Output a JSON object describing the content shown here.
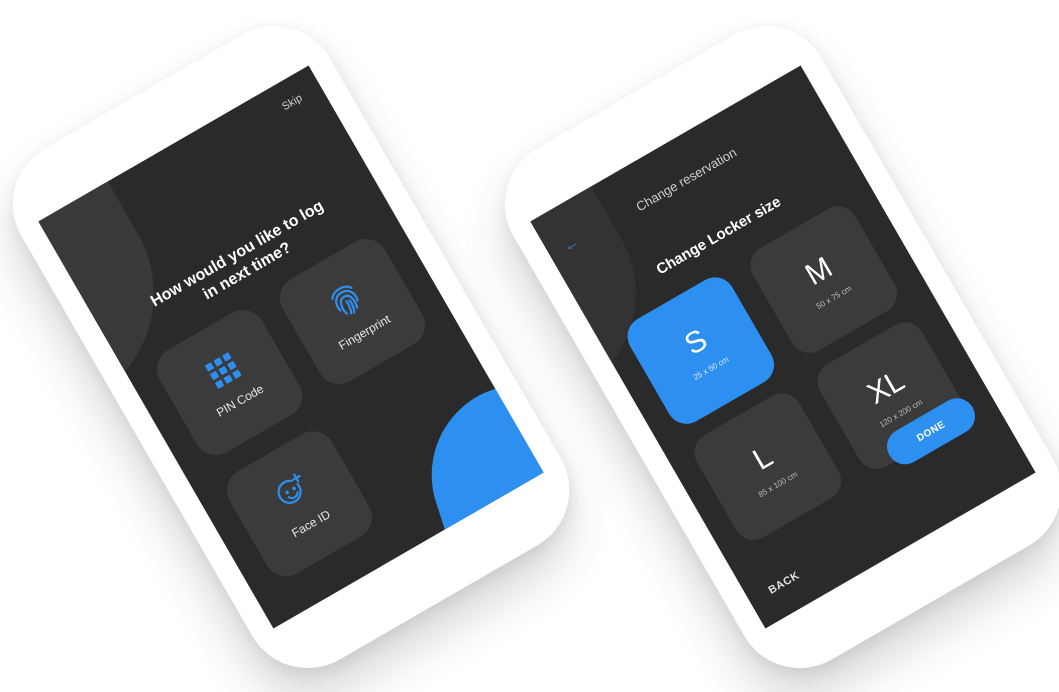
{
  "login_screen": {
    "skip_label": "Skip",
    "title": "How would you like to log\nin next time?",
    "options": [
      {
        "label": "PIN Code",
        "icon": "keypad-icon"
      },
      {
        "label": "Fingerprint",
        "icon": "fingerprint-icon"
      },
      {
        "label": "Face ID",
        "icon": "face-id-icon"
      }
    ]
  },
  "reservation_screen": {
    "header_title": "Change reservation",
    "section_title": "Change Locker size",
    "back_arrow_icon": "back-arrow-icon",
    "sizes": [
      {
        "letter": "S",
        "dims": "25 x 50 cm",
        "selected": true
      },
      {
        "letter": "M",
        "dims": "50 x 75 cm",
        "selected": false
      },
      {
        "letter": "L",
        "dims": "85 x 100 cm",
        "selected": false
      },
      {
        "letter": "XL",
        "dims": "120 x 200 cm",
        "selected": false
      }
    ],
    "done_label": "DONE",
    "back_label": "BACK"
  },
  "colors": {
    "accent": "#2d8ff0",
    "screen_bg": "#2b2a2a",
    "tile_bg": "#3c3b3b"
  }
}
